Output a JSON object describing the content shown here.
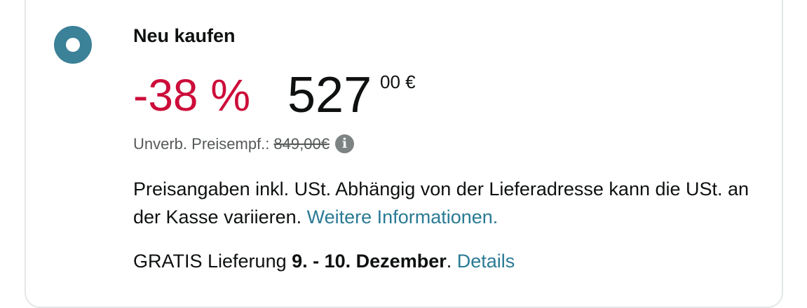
{
  "option": {
    "title": "Neu kaufen",
    "selected": true
  },
  "price": {
    "discount": "-38 %",
    "whole": "527",
    "fraction_currency": "00 €"
  },
  "list_price": {
    "label": "Unverb. Preisempf.:",
    "value": "849,00€",
    "info_icon": "i"
  },
  "tax": {
    "text": "Preisangaben inkl. USt. Abhängig von der Lieferadresse kann die USt. an der Kasse variieren.",
    "link": "Weitere Informationen."
  },
  "delivery": {
    "prefix": "GRATIS Lieferung",
    "dates": "9. - 10. Dezember",
    "suffix": ".",
    "link": "Details"
  },
  "colors": {
    "discount": "#cc0c39",
    "link": "#2a7a94",
    "radio": "#3b8197"
  }
}
